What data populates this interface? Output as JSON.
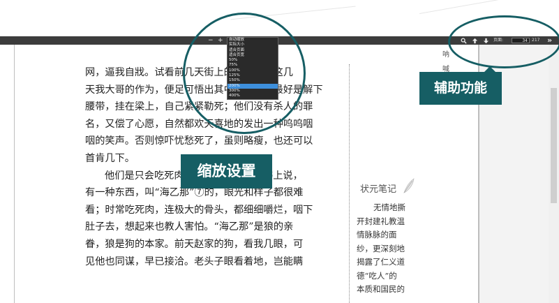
{
  "toolbar": {
    "zoom_out": "−",
    "zoom_in": "+",
    "zoom_current": "",
    "zoom_options": [
      "自动缩放",
      "实际大小",
      "适合页面",
      "适合页宽",
      "50%",
      "75%",
      "100%",
      "125%",
      "150%",
      "200%",
      "300%",
      "400%"
    ],
    "zoom_selected_index": 9,
    "page_label": "页面:",
    "page_current": "34",
    "page_total": "217",
    "more": "»"
  },
  "body_lines": [
    "网，逼我自戕。试看前几天街上的样子，和这几",
    "天我大哥的作为，便足可悟出其中的道理。最好是解下",
    "腰带，挂在梁上，自己紧紧勒死；他们没有杀人的罪",
    "名，又偿了心愿，自然都欢天喜地的发出一种呜呜咽",
    "咽的笑声。否则惊吓忧愁死了，虽则略瘦，也还可以",
    "首肯几下。",
    "他们是只会吃死肉的！——记得什么书上说，",
    "有一种东西，叫“海乙那”⑦的，眼光和样子都很难",
    "看；时常吃死肉，连极大的骨头，都细细嚼烂，咽下",
    "肚子去，想起来也教人害怕。“海乙那”是狼的亲",
    "眷，狼是狗的本家。前天赵家的狗，看我几眼，可",
    "见他也同谋，早已接洽。老头子眼看着地，岂能瞒"
  ],
  "side_vertical_chars": [
    "呐",
    "喊"
  ],
  "notes": {
    "title": "状元笔记",
    "lines": [
      "无情地撕",
      "开封建礼教温",
      "情脉脉的面",
      "纱，更深刻地",
      "揭露了仁义道",
      "德“吃人”的",
      "本质和国民的"
    ]
  },
  "callouts": {
    "zoom_settings": "缩放设置",
    "aux_functions": "辅助功能"
  },
  "colors": {
    "accent": "#165e64",
    "toolbar_bg": "#3c3c3c",
    "selected_option": "#3d8fdc"
  }
}
